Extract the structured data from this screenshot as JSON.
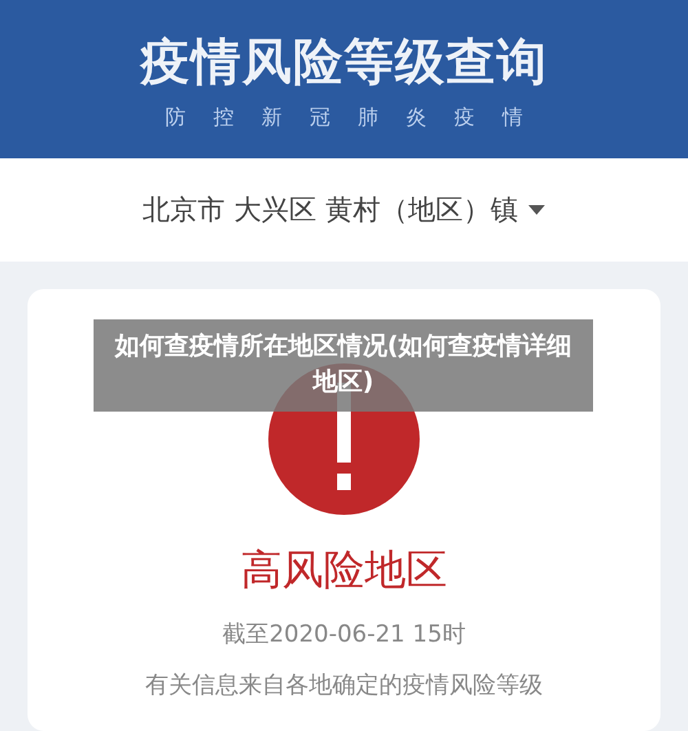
{
  "header": {
    "title": "疫情风险等级查询",
    "subtitle": [
      "防",
      "控",
      "新",
      "冠",
      "肺",
      "炎",
      "疫",
      "情"
    ]
  },
  "location": {
    "value": "北京市 大兴区 黄村（地区）镇"
  },
  "result": {
    "kind": "high",
    "label": "高风险地区",
    "date": "截至2020-06-21 15时",
    "note": "有关信息来自各地确定的疫情风险等级"
  },
  "caption": {
    "text": "如何查疫情所在地区情况(如何查疫情详细地区)"
  }
}
